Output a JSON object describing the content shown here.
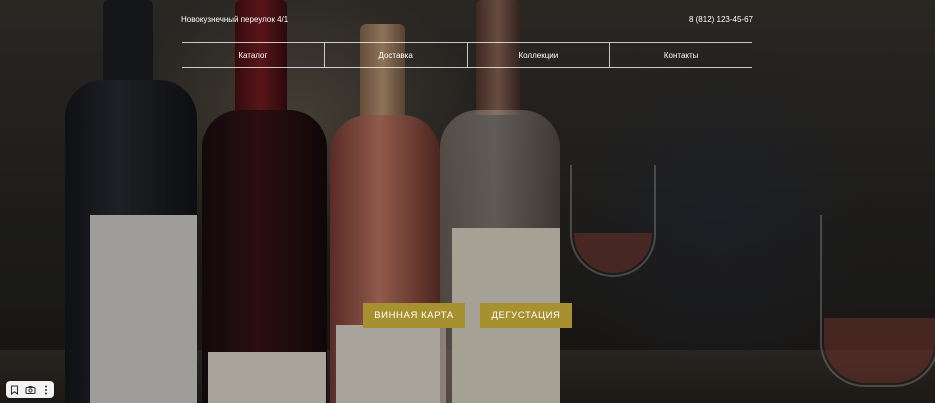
{
  "header": {
    "address": "Новокузнечный переулок 4/1",
    "phone": "8 (812) 123-45-67"
  },
  "nav": {
    "items": [
      {
        "label": "Каталог"
      },
      {
        "label": "Доставка"
      },
      {
        "label": "Коллекции"
      },
      {
        "label": "Контакты"
      }
    ]
  },
  "buttons": {
    "wine_list": "ВИННАЯ КАРТА",
    "tasting": "ДЕГУСТАЦИЯ"
  },
  "colors": {
    "accent": "#a6902f"
  },
  "toolbar": {
    "icons": [
      "bookmark-icon",
      "camera-icon",
      "more-vertical-icon"
    ]
  }
}
